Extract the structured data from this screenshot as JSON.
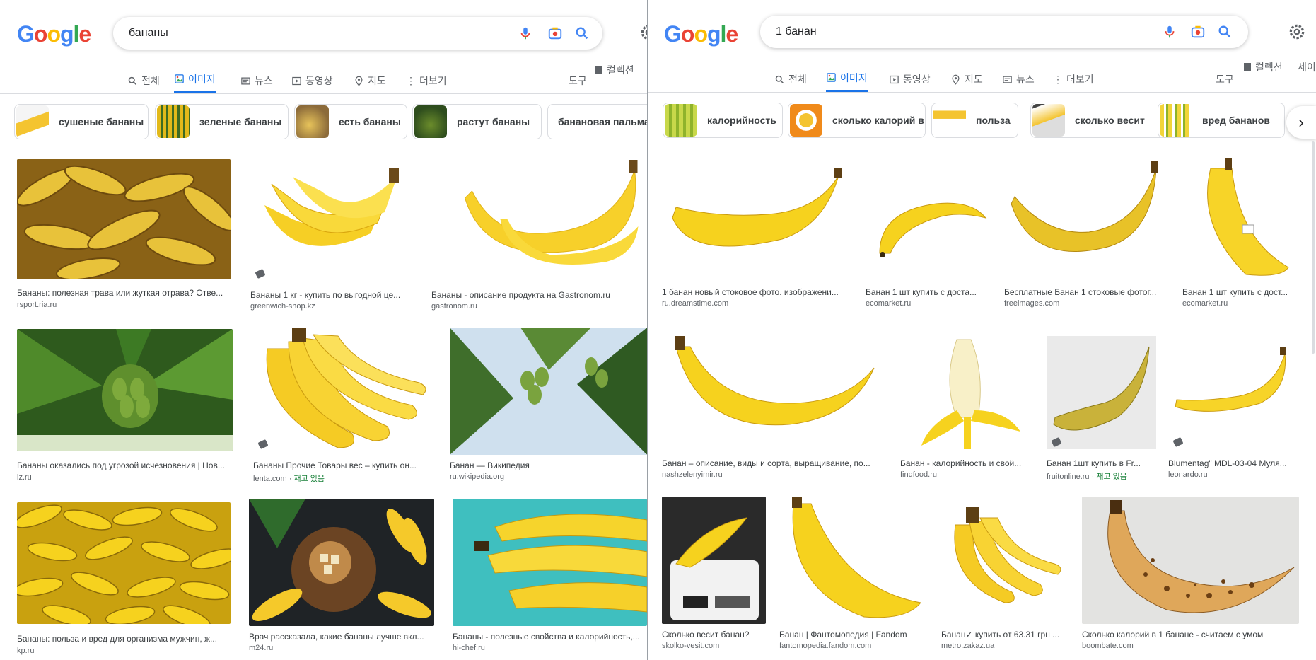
{
  "colors": {
    "accent": "#1a73e8",
    "stock_green": "#188038",
    "banana": "#f2c91d"
  },
  "logo": {
    "letters": [
      "G",
      "o",
      "o",
      "g",
      "l",
      "e"
    ]
  },
  "left": {
    "query": "бананы",
    "tabs": [
      "전체",
      "이미지",
      "뉴스",
      "동영상",
      "지도",
      "더보기"
    ],
    "active_tab": "이미지",
    "tools": "도구",
    "collections": "컬렉션",
    "chips": [
      "сушеные бананы",
      "зеленые бананы",
      "есть бананы",
      "растут бананы",
      "банановая пальма"
    ],
    "results": [
      {
        "caption": "Бананы: полезная трава или жуткая отрава? Отве...",
        "source": "rsport.ria.ru"
      },
      {
        "caption": "Бананы 1 кг - купить по выгодной це...",
        "source": "greenwich-shop.kz"
      },
      {
        "caption": "Бананы - описание продукта на Gastronom.ru",
        "source": "gastronom.ru"
      },
      {
        "caption": "Бананы оказались под угрозой исчезновения | Нов...",
        "source": "iz.ru"
      },
      {
        "caption": "Бананы Прочие Товары вес – купить он...",
        "source": "lenta.com",
        "stock": "재고 있음"
      },
      {
        "caption": "Банан — Википедия",
        "source": "ru.wikipedia.org"
      },
      {
        "caption": "Бананы: польза и вред для организма мужчин, ж...",
        "source": "kp.ru"
      },
      {
        "caption": "Врач рассказала, какие бананы лучше вкл...",
        "source": "m24.ru"
      },
      {
        "caption": "Бананы - полезные свойства и калорийность,...",
        "source": "hi-chef.ru"
      }
    ]
  },
  "right": {
    "query": "1 банан",
    "tabs": [
      "전체",
      "이미지",
      "동영상",
      "지도",
      "뉴스",
      "더보기"
    ],
    "active_tab": "이미지",
    "tools": "도구",
    "collections": "컬렉션",
    "safesearch": "세이",
    "chips": [
      "калорийность",
      "сколько калорий в",
      "польза",
      "сколько весит",
      "вред бананов"
    ],
    "results": [
      {
        "caption": "1 банан новый стоковое фото. изображени...",
        "source": "ru.dreamstime.com"
      },
      {
        "caption": "Банан 1 шт купить с доста...",
        "source": "ecomarket.ru"
      },
      {
        "caption": "Бесплатные Банан 1 стоковые фотог...",
        "source": "freeimages.com"
      },
      {
        "caption": "Банан 1 шт купить с дост...",
        "source": "ecomarket.ru"
      },
      {
        "caption": "Банан – описание, виды и сорта, выращивание, по...",
        "source": "nashzelenyimir.ru"
      },
      {
        "caption": "Банан - калорийность и свой...",
        "source": "findfood.ru"
      },
      {
        "caption": "Банан 1шт купить в Fr...",
        "source": "fruitonline.ru",
        "stock": "재고 있음"
      },
      {
        "caption": "Blumentag\" MDL-03-04 Муля...",
        "source": "leonardo.ru"
      },
      {
        "caption": "Сколько весит банан?",
        "source": "skolko-vesit.com"
      },
      {
        "caption": "Банан | Фантомопедия | Fandom",
        "source": "fantomopedia.fandom.com"
      },
      {
        "caption": "Банан✓ купить от 63.31 грн ...",
        "source": "metro.zakaz.ua"
      },
      {
        "caption": "Сколько калорий в 1 банане - считаем с умом",
        "source": "boombate.com"
      }
    ]
  }
}
